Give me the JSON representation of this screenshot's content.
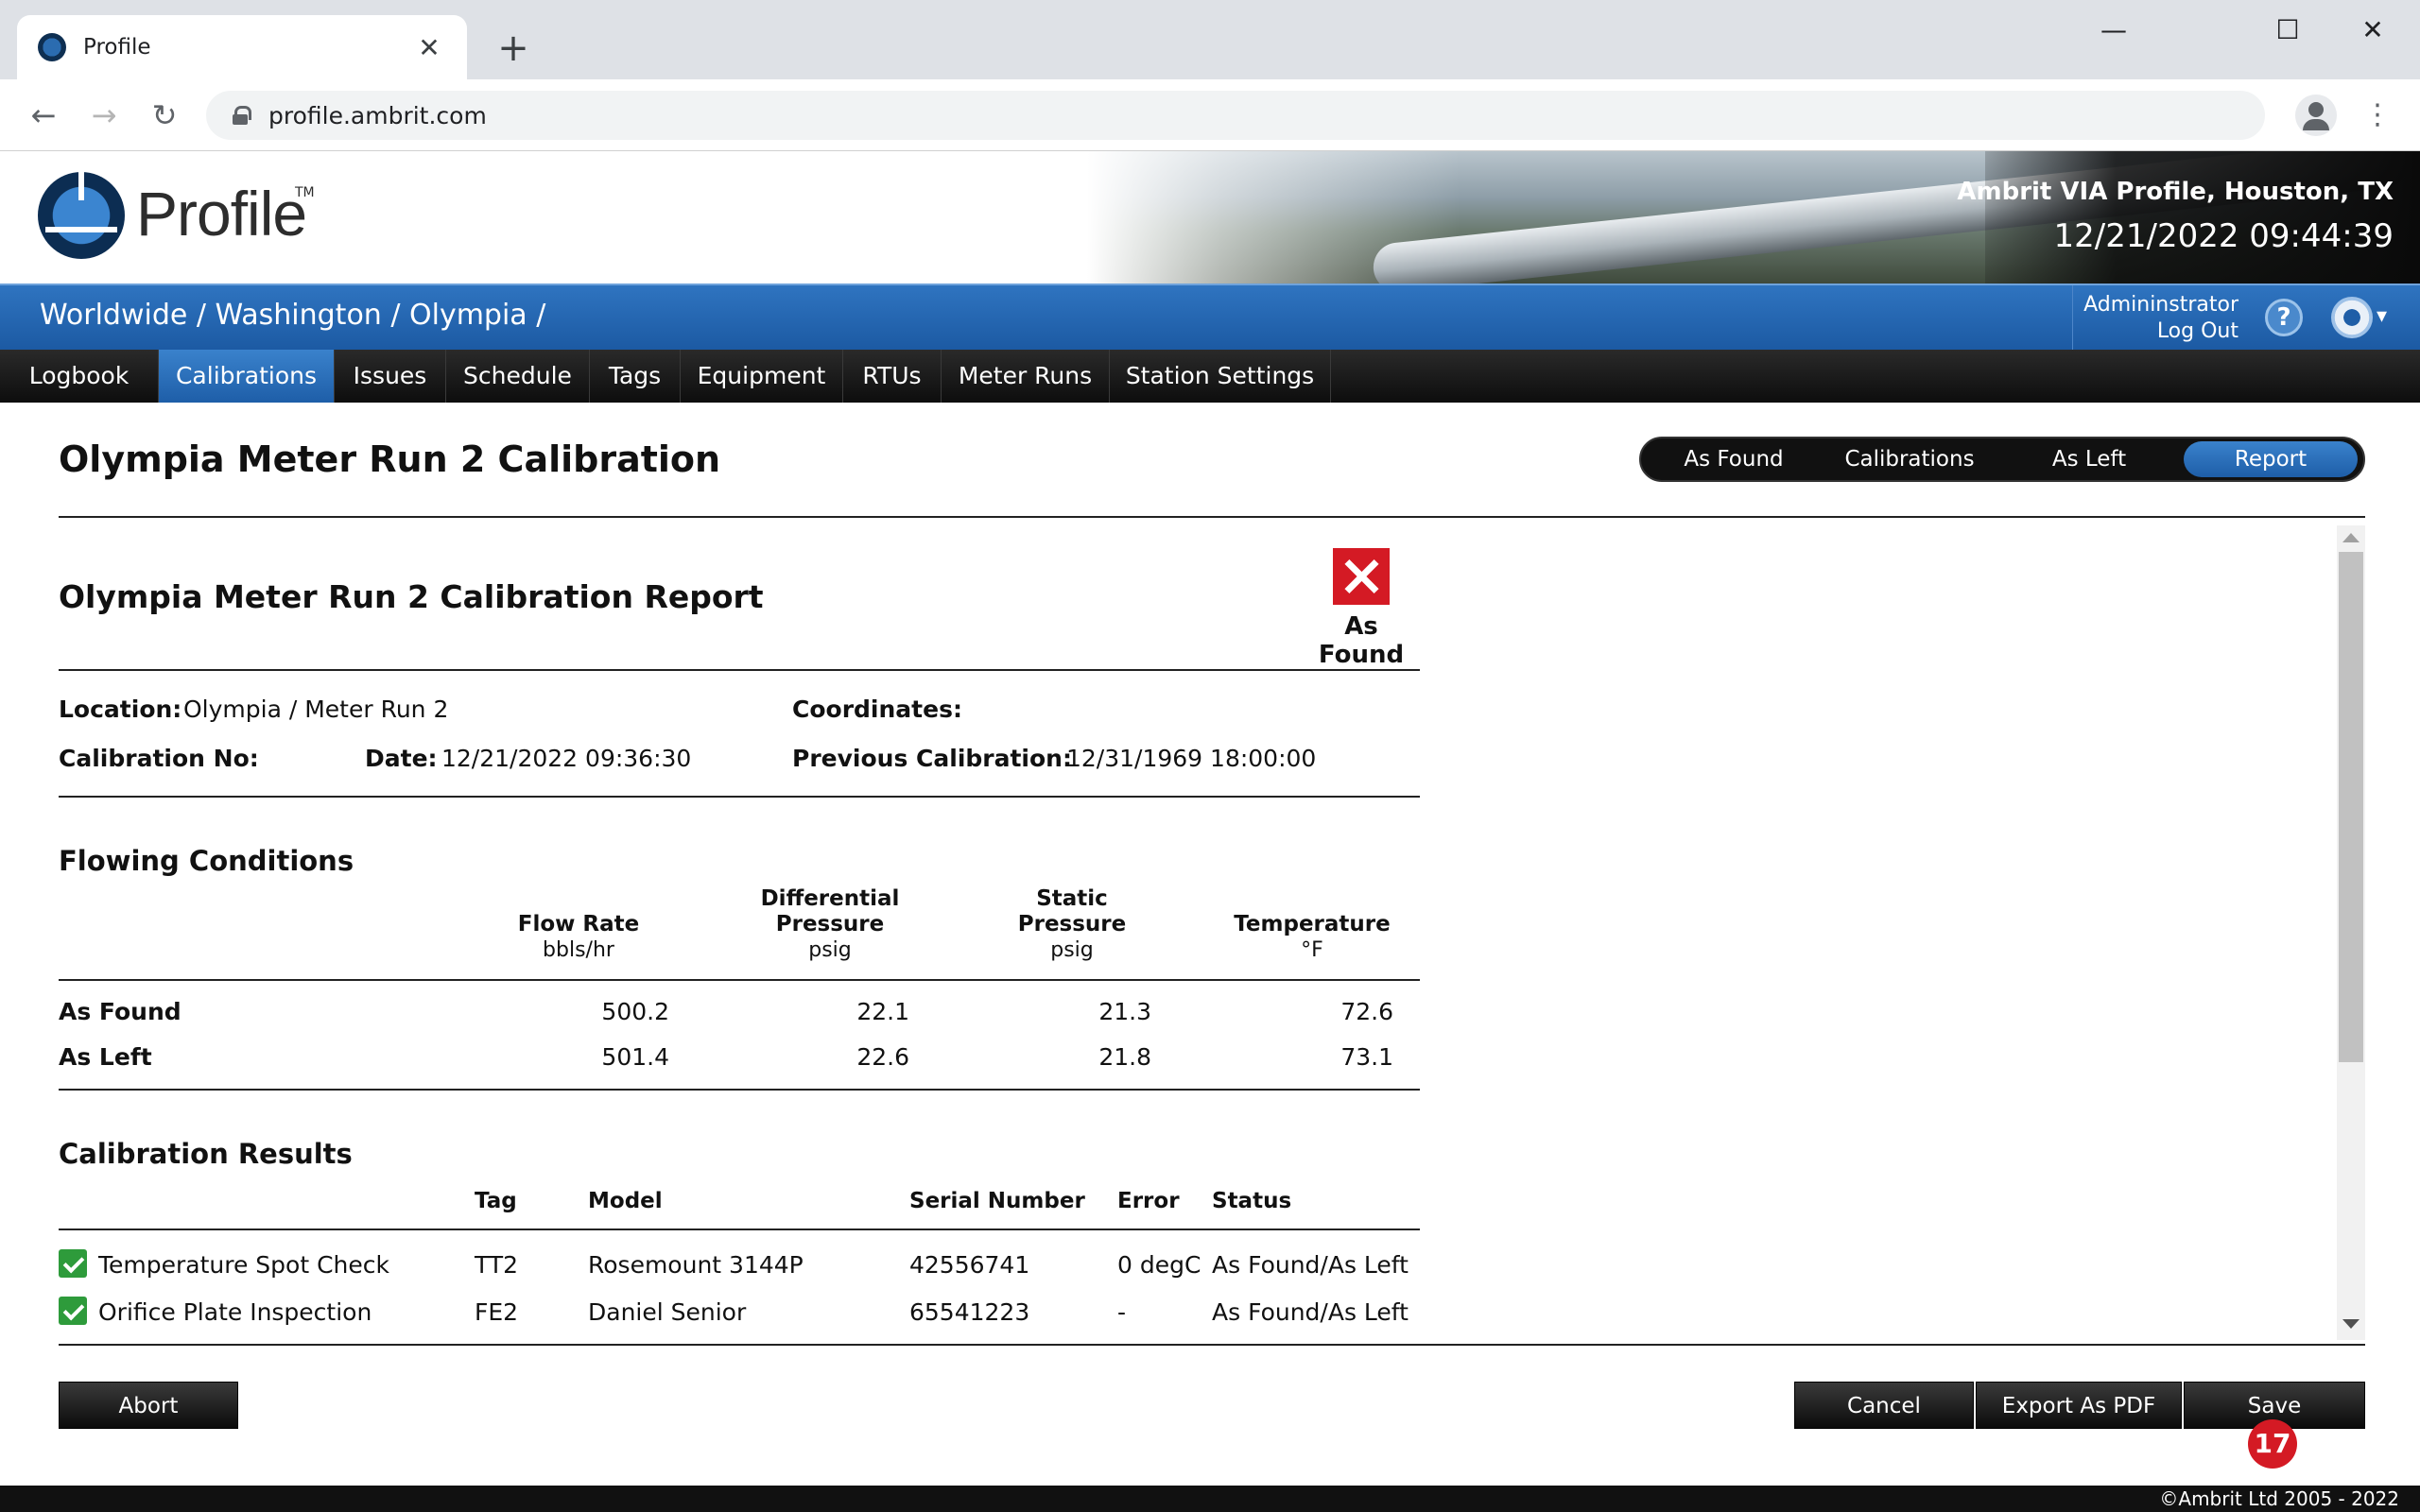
{
  "browser": {
    "tab_title": "Profile",
    "url": "profile.ambrit.com",
    "new_tab": "+",
    "close_tab": "✕",
    "minimize": "—",
    "maximize": "☐",
    "close_window": "✕",
    "back": "←",
    "forward": "→",
    "reload": "↻",
    "menu": "⋮"
  },
  "header": {
    "logo_text": "Profile",
    "logo_tm": "TM",
    "site": "Ambrit VIA Profile, Houston, TX",
    "clock": "12/21/2022 09:44:39"
  },
  "bluebar": {
    "breadcrumb": "Worldwide / Washington / Olympia /",
    "user": "Admininstrator",
    "logout": "Log Out",
    "help": "?",
    "gear_caret": "▾"
  },
  "nav": {
    "items": [
      "Logbook",
      "Calibrations",
      "Issues",
      "Schedule",
      "Tags",
      "Equipment",
      "RTUs",
      "Meter Runs",
      "Station Settings"
    ],
    "active": "Calibrations"
  },
  "page": {
    "title": "Olympia Meter Run 2 Calibration",
    "segments": [
      "As Found",
      "Calibrations",
      "As Left",
      "Report"
    ],
    "active_segment": "Report"
  },
  "report": {
    "title": "Olympia Meter Run 2 Calibration Report",
    "status_label": "As Found",
    "location_label": "Location:",
    "location_value": "Olympia / Meter Run 2",
    "coordinates_label": "Coordinates:",
    "calibration_no_label": "Calibration No:",
    "date_label": "Date:",
    "date_value": "12/21/2022 09:36:30",
    "previous_label": "Previous Calibration:",
    "previous_value": "12/31/1969 18:00:00",
    "flowing": {
      "heading": "Flowing Conditions",
      "columns": [
        {
          "line1": "",
          "line2": "Flow Rate",
          "unit": "bbls/hr"
        },
        {
          "line1": "Differential",
          "line2": "Pressure",
          "unit": "psig"
        },
        {
          "line1": "Static",
          "line2": "Pressure",
          "unit": "psig"
        },
        {
          "line1": "",
          "line2": "Temperature",
          "unit": "°F"
        }
      ],
      "rows": [
        {
          "label": "As Found",
          "values": [
            "500.2",
            "22.1",
            "21.3",
            "72.6"
          ]
        },
        {
          "label": "As Left",
          "values": [
            "501.4",
            "22.6",
            "21.8",
            "73.1"
          ]
        }
      ]
    },
    "results": {
      "heading": "Calibration Results",
      "columns": [
        "Tag",
        "Model",
        "Serial Number",
        "Error",
        "Status"
      ],
      "rows": [
        {
          "name": "Temperature Spot Check",
          "tag": "TT2",
          "model": "Rosemount 3144P",
          "serial": "42556741",
          "error": "0 degC",
          "status": "As Found/As Left"
        },
        {
          "name": "Orifice Plate Inspection",
          "tag": "FE2",
          "model": "Daniel Senior",
          "serial": "65541223",
          "error": "-",
          "status": "As Found/As Left"
        }
      ]
    }
  },
  "buttons": {
    "abort": "Abort",
    "cancel": "Cancel",
    "export": "Export As PDF",
    "save": "Save",
    "badge": "17"
  },
  "footer": {
    "copyright": "©Ambrit Ltd 2005 - 2022"
  }
}
